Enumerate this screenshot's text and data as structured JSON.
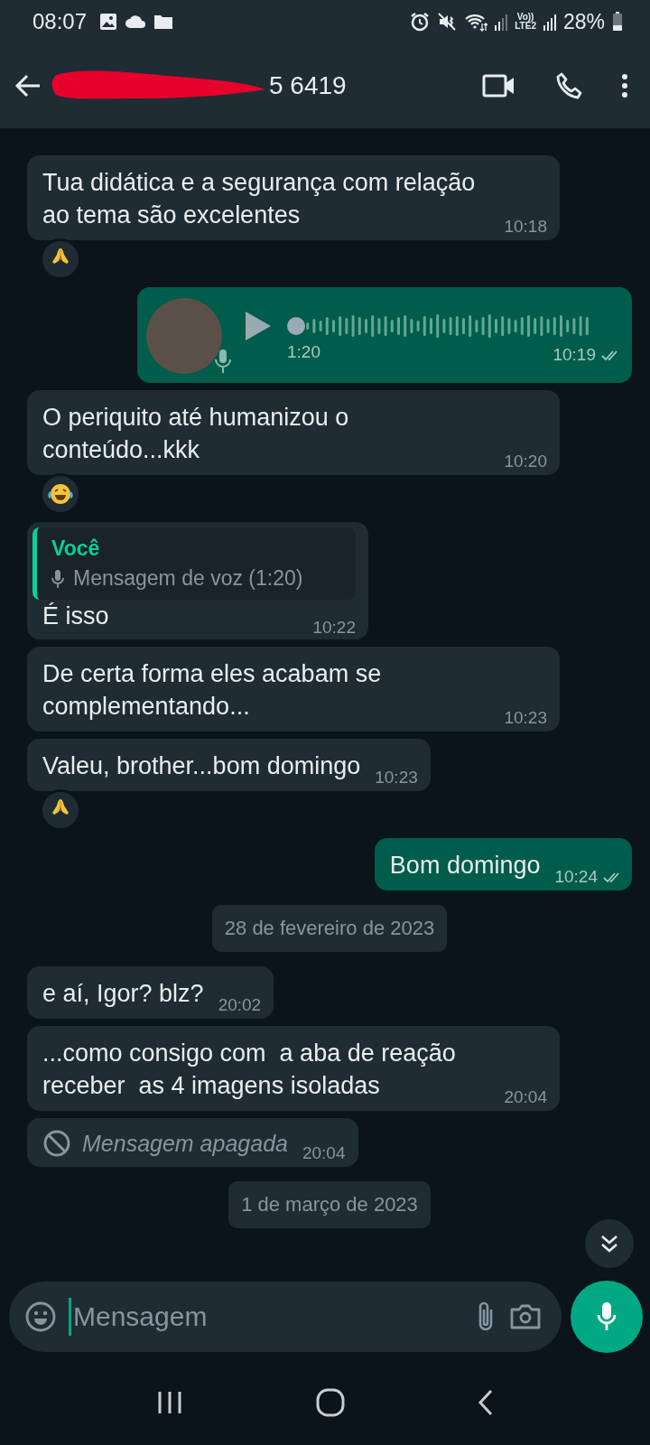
{
  "status_bar": {
    "time": "08:07",
    "volte_top": "Vo))",
    "volte_bottom": "LTE2",
    "battery": "28%"
  },
  "header": {
    "title": "5 6419"
  },
  "messages": [
    {
      "kind": "text",
      "outgoing": false,
      "text": "Tua didática e a segurança com relação\nao tema são excelentes",
      "time": "10:18",
      "reaction": {
        "kind": "folded_hands"
      }
    },
    {
      "kind": "voice",
      "outgoing": true,
      "duration": "1:20",
      "time": "10:19",
      "level": 0,
      "delivered": true
    },
    {
      "kind": "text",
      "outgoing": false,
      "text": "O periquito até humanizou o\nconteúdo...kkk",
      "time": "10:20",
      "reaction": {
        "kind": "laughing"
      }
    },
    {
      "kind": "reply",
      "outgoing": false,
      "quote_author": "Você",
      "quote_text": "Mensagem de voz (1:20)",
      "text": "É isso",
      "time": "10:22"
    },
    {
      "kind": "text",
      "outgoing": false,
      "text": "De certa forma eles acabam se\ncomplementando...",
      "time": "10:23"
    },
    {
      "kind": "text",
      "outgoing": false,
      "text": "Valeu, brother...bom domingo",
      "time": "10:23",
      "reaction": {
        "kind": "folded_hands"
      }
    },
    {
      "kind": "text",
      "outgoing": true,
      "text": "Bom domingo",
      "time": "10:24",
      "delivered": true
    },
    {
      "kind": "date",
      "text": "28 de fevereiro de 2023"
    },
    {
      "kind": "text",
      "outgoing": false,
      "text": "e aí, Igor? blz?",
      "time": "20:02"
    },
    {
      "kind": "text",
      "outgoing": false,
      "text": "...como consigo com  a aba de reação\nreceber  as 4 imagens isoladas",
      "time": "20:04"
    },
    {
      "kind": "deleted",
      "outgoing": false,
      "text": "Mensagem apagada",
      "time": "20:04"
    },
    {
      "kind": "date",
      "text": "1 de março de 2023"
    }
  ],
  "composer": {
    "placeholder": "Mensagem"
  }
}
